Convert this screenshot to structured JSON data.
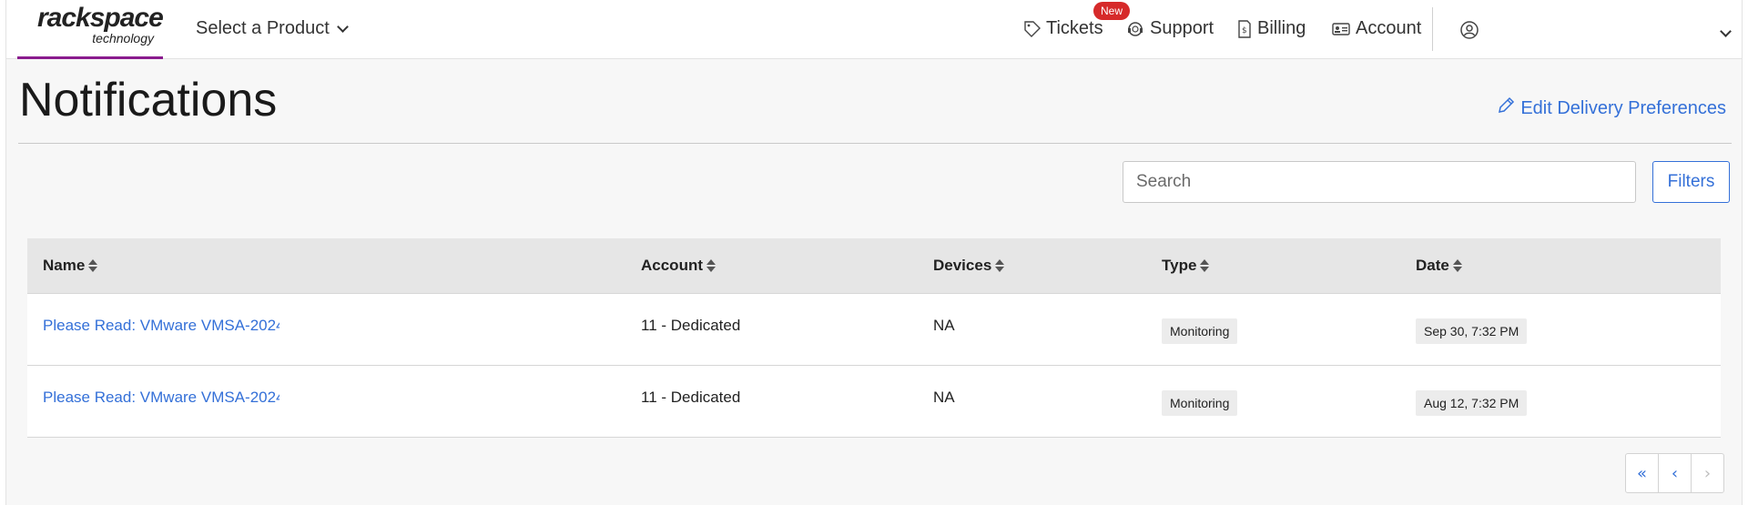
{
  "header": {
    "logo_main": "rackspace",
    "logo_sub": "technology",
    "product_select_label": "Select a Product",
    "badge_new": "New",
    "nav": {
      "tickets": "Tickets",
      "support": "Support",
      "billing": "Billing",
      "account": "Account"
    }
  },
  "page": {
    "title": "Notifications",
    "edit_preferences": "Edit Delivery Preferences"
  },
  "toolbar": {
    "search_placeholder": "Search",
    "filters_label": "Filters"
  },
  "table": {
    "columns": [
      "Name",
      "Account",
      "Devices",
      "Type",
      "Date"
    ],
    "rows": [
      {
        "name": "Please Read: VMware VMSA-2024",
        "account": "11 - Dedicated",
        "devices": "NA",
        "type": "Monitoring",
        "date": "Sep 30, 7:32 PM"
      },
      {
        "name": "Please Read: VMware VMSA-2024",
        "account": "11 - Dedicated",
        "devices": "NA",
        "type": "Monitoring",
        "date": "Aug 12, 7:32 PM"
      }
    ]
  },
  "pagination": {
    "first": "«",
    "prev": "‹",
    "next": "›"
  },
  "colors": {
    "accent": "#3470d8",
    "brand_underline": "#8a1b8e",
    "badge": "#d62a2a"
  }
}
